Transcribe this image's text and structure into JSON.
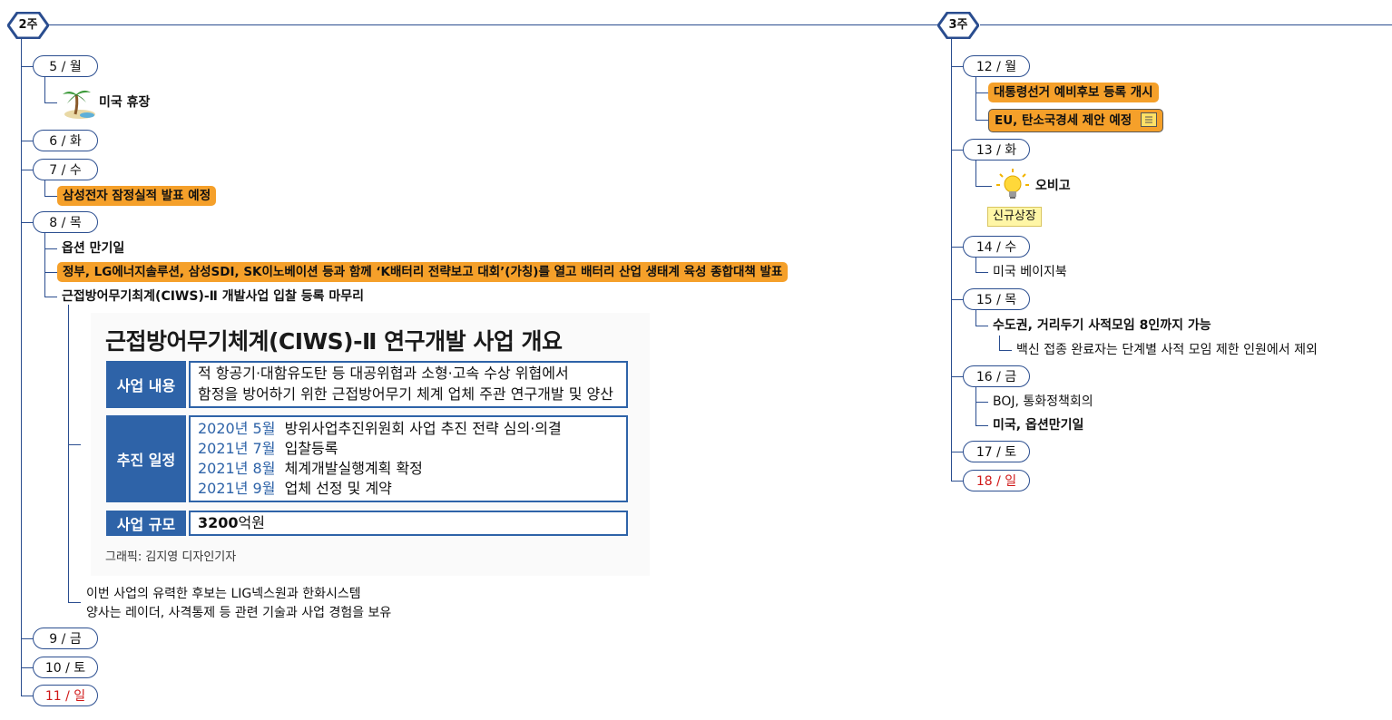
{
  "week2": {
    "label": "2주",
    "days": {
      "d5": "5 / 월",
      "d6": "6 / 화",
      "d7": "7 / 수",
      "d8": "8 / 목",
      "d9": "9 / 금",
      "d10": "10 / 토",
      "d11": "11 / 일"
    },
    "items": {
      "us_holiday": "미국 휴장",
      "samsung": "삼성전자 잠정실적 발표 예정",
      "options": "옵션 만기일",
      "battery": "정부, LG에너지솔루션, 삼성SDI, SK이노베이션 등과 함께 ‘K배터리 전략보고 대회’(가칭)를 열고 배터리 산업 생태계 육성 종합대책 발표",
      "ciws_bid": "근접방어무기최계(CIWS)-Ⅱ 개발사업 입찰 등록 마무리",
      "note_line1": "이번 사업의 유력한 후보는 LIG넥스원과 한화시스템",
      "note_line2": "양사는 레이더, 사격통제 등 관련 기술과 사업 경험을 보유"
    },
    "graphic": {
      "title": "근접방어무기체계(CIWS)-Ⅱ 연구개발 사업 개요",
      "content_label": "사업 내용",
      "content_line1": "적 항공기·대함유도탄 등 대공위협과 소형·고속 수상 위협에서",
      "content_line2": "함정을 방어하기 위한 근접방어무기 체계 업체 주관 연구개발 및 양산",
      "schedule_label": "추진 일정",
      "schedule": [
        {
          "date": "2020년 5월",
          "text": "방위사업추진위원회 사업 추진 전략 심의·의결"
        },
        {
          "date": "2021년 7월",
          "text": "입찰등록"
        },
        {
          "date": "2021년 8월",
          "text": "체계개발실행계획 확정"
        },
        {
          "date": "2021년 9월",
          "text": "업체 선정 및 계약"
        }
      ],
      "scale_label": "사업 규모",
      "scale_amount": "3200",
      "scale_unit": "억원",
      "credit": "그래픽: 김지영 디자인기자"
    }
  },
  "week3": {
    "label": "3주",
    "days": {
      "d12": "12 / 월",
      "d13": "13 / 화",
      "d14": "14 / 수",
      "d15": "15 / 목",
      "d16": "16 / 금",
      "d17": "17 / 토",
      "d18": "18 / 일"
    },
    "items": {
      "election": "대통령선거 예비후보 등록 개시",
      "eu_carbon": "EU, 탄소국경세 제안 예정",
      "obigo": "오비고",
      "new_listing": "신규상장",
      "us_beige": "미국 베이지북",
      "capital": "수도권, 거리두기 사적모임 8인까지 가능",
      "vaccine": "백신 접종 완료자는 단계별 사적 모임 제한 인원에서 제외",
      "boj": "BOJ, 통화정책회의",
      "us_options": "미국, 옵션만기일"
    }
  },
  "colors": {
    "line": "#2a4d8f",
    "highlight": "#f5a02a",
    "sunday": "#d01818",
    "tag": "#fff6a6",
    "graphic_blue": "#2e63a8"
  }
}
